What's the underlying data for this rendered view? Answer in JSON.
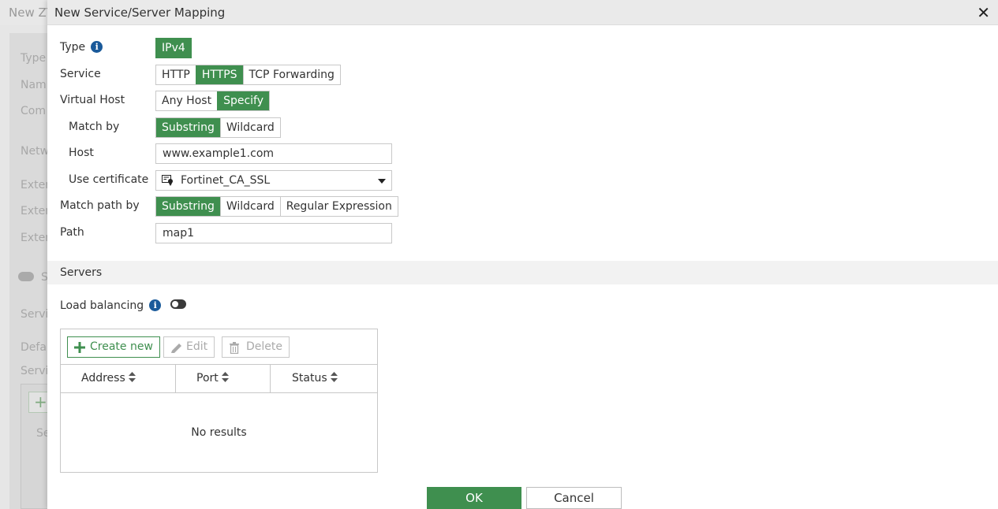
{
  "background": {
    "title": "New ZT",
    "labels": [
      "Type",
      "Nam",
      "Com",
      "Netw",
      "Exter",
      "Exter",
      "Exter",
      "S",
      "Servi",
      "Defa",
      "Servi",
      "Se"
    ]
  },
  "dialog": {
    "title": "New Service/Server Mapping",
    "close_icon": "close-icon"
  },
  "form": {
    "type": {
      "label": "Type",
      "options": [
        "IPv4"
      ],
      "selected": "IPv4"
    },
    "service": {
      "label": "Service",
      "options": [
        "HTTP",
        "HTTPS",
        "TCP Forwarding"
      ],
      "selected": "HTTPS"
    },
    "virtual_host": {
      "label": "Virtual Host",
      "options": [
        "Any Host",
        "Specify"
      ],
      "selected": "Specify"
    },
    "match_by": {
      "label": "Match by",
      "options": [
        "Substring",
        "Wildcard"
      ],
      "selected": "Substring"
    },
    "host": {
      "label": "Host",
      "value": "www.example1.com"
    },
    "use_certificate": {
      "label": "Use certificate",
      "value": "Fortinet_CA_SSL",
      "icon": "certificate-icon"
    },
    "match_path_by": {
      "label": "Match path by",
      "options": [
        "Substring",
        "Wildcard",
        "Regular Expression"
      ],
      "selected": "Substring"
    },
    "path": {
      "label": "Path",
      "value": "map1"
    }
  },
  "servers": {
    "section_title": "Servers",
    "load_balancing": {
      "label": "Load balancing",
      "enabled": false
    },
    "toolbar": {
      "create_new": "Create new",
      "edit": "Edit",
      "delete": "Delete"
    },
    "columns": [
      "Address",
      "Port",
      "Status"
    ],
    "empty_text": "No results"
  },
  "footer": {
    "ok": "OK",
    "cancel": "Cancel"
  },
  "colors": {
    "accent": "#3f8f4f",
    "info": "#1a5a9a"
  }
}
